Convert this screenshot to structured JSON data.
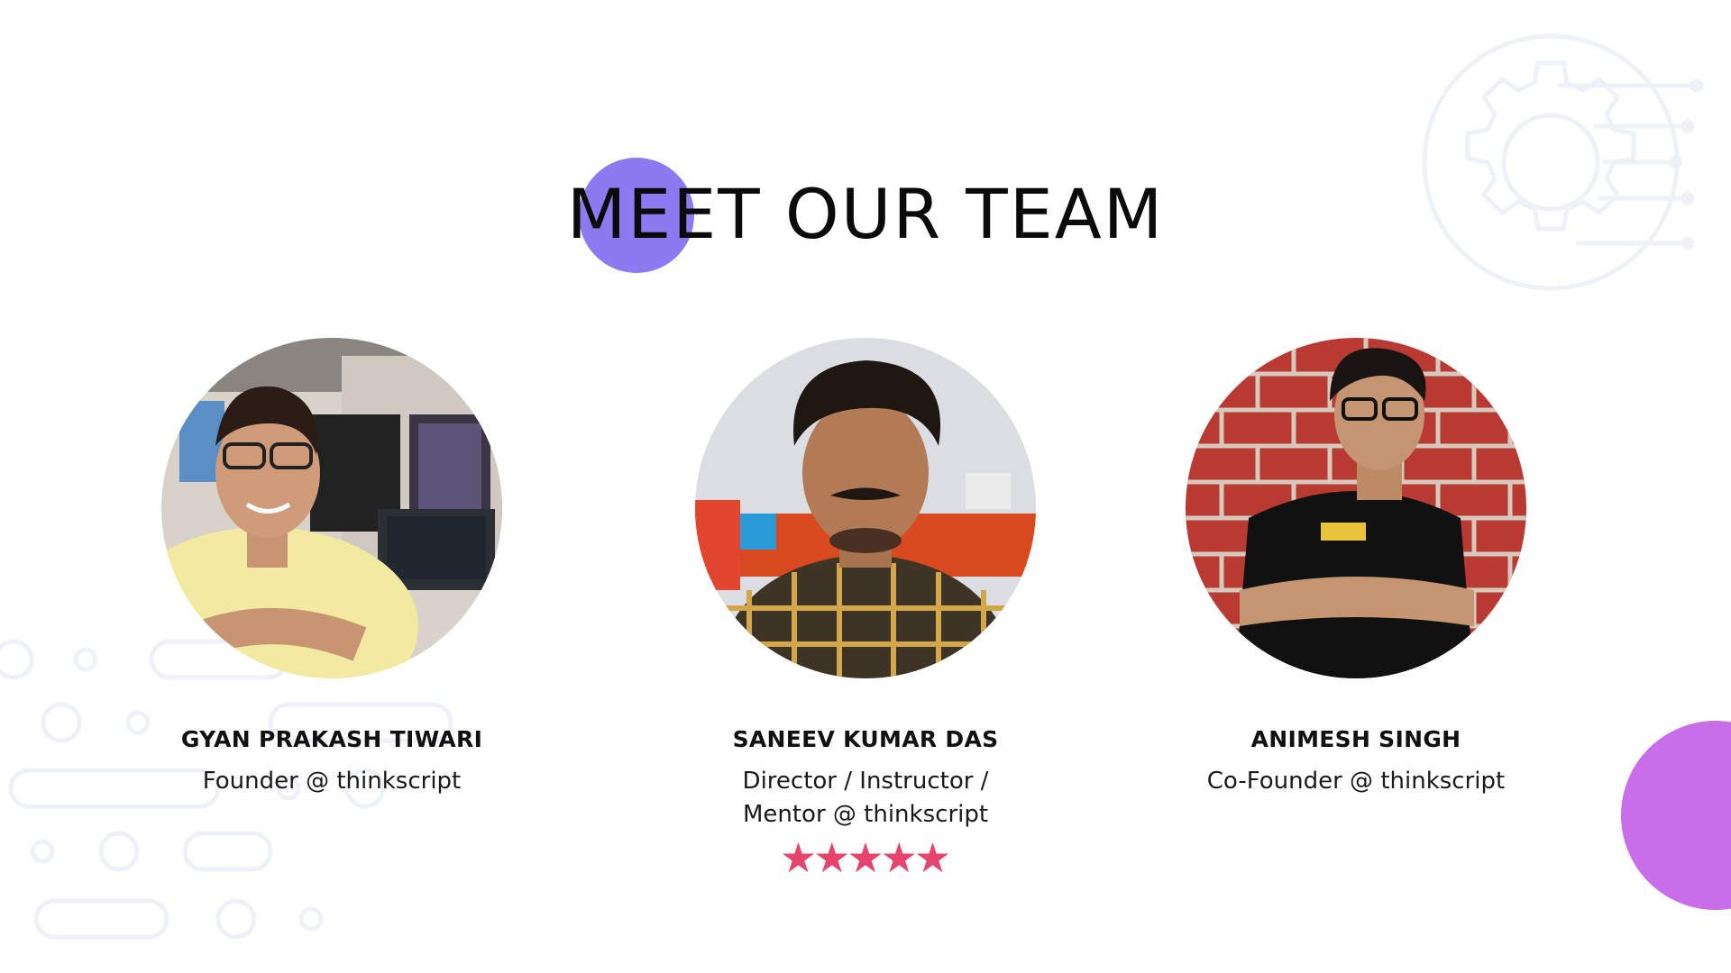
{
  "page": {
    "title": "MEET OUR TEAM"
  },
  "team": {
    "members": [
      {
        "name": "GYAN PRAKASH TIWARI",
        "role_lines": [
          "Founder @ thinkscript"
        ],
        "avatar": "photo-of-man-with-glasses-yellow-tshirt"
      },
      {
        "name": "SANEEV KUMAR DAS",
        "role_lines": [
          "Director / Instructor /",
          "Mentor @ thinkscript"
        ],
        "avatar": "photo-of-man-with-mustache-checked-shirt",
        "rating": {
          "stars": 5,
          "max": 5
        }
      },
      {
        "name": "ANIMESH SINGH",
        "role_lines": [
          "Co-Founder @ thinkscript"
        ],
        "avatar": "photo-of-man-with-glasses-black-tshirt"
      }
    ]
  },
  "colors": {
    "title_accent": "#8d7af0",
    "blob_accent": "#c86ee8",
    "star": "#e5456d",
    "decor": "#eef1f7"
  },
  "icons": {
    "background_graphic": "gear-circuit-icon",
    "star": "star-icon"
  }
}
